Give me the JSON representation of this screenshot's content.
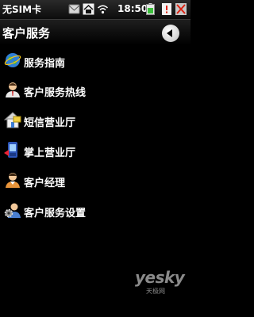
{
  "status_bar": {
    "carrier": "无SIM卡",
    "time": "18:50",
    "icons": [
      "message-icon",
      "home-icon",
      "wifi-icon",
      "battery-icon",
      "notification-icon",
      "no-sim-icon"
    ]
  },
  "header": {
    "title": "客户服务",
    "back_icon": "back-arrow-icon"
  },
  "menu": {
    "items": [
      {
        "label": "服务指南",
        "icon": "globe-icon"
      },
      {
        "label": "客户服务热线",
        "icon": "person-icon"
      },
      {
        "label": "短信营业厅",
        "icon": "house-icon"
      },
      {
        "label": "掌上营业厅",
        "icon": "phone-icon"
      },
      {
        "label": "客户经理",
        "icon": "manager-icon"
      },
      {
        "label": "客户服务设置",
        "icon": "person-gear-icon"
      }
    ]
  },
  "watermark": {
    "logo": "yesky",
    "sub": "天极网"
  }
}
